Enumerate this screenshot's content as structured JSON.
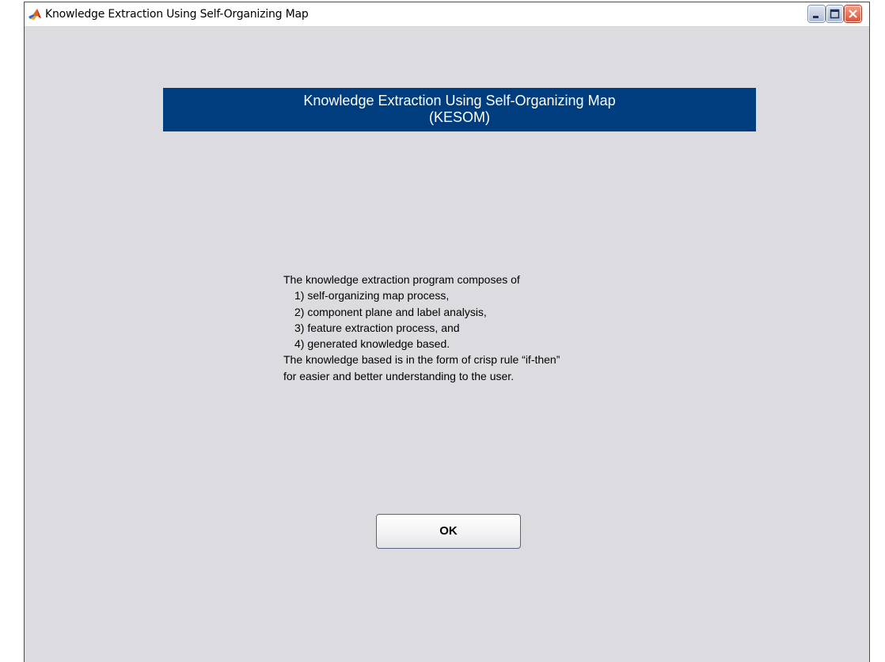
{
  "window": {
    "title": "Knowledge Extraction Using Self-Organizing Map",
    "controls": [
      "minimize-icon",
      "maximize-icon",
      "close-icon"
    ]
  },
  "header": {
    "line1": "Knowledge Extraction Using Self-Organizing Map",
    "line2": "(KESOM)"
  },
  "description": {
    "intro": "The knowledge extraction program composes of",
    "items": [
      "1) self-organizing map process,",
      "2) component plane and label analysis,",
      "3) feature extraction process, and",
      "4) generated knowledge based."
    ],
    "outro1": "The knowledge based is in the form of crisp rule “if-then”",
    "outro2": "for easier and better understanding to the user."
  },
  "actions": {
    "ok_label": "OK"
  },
  "colors": {
    "banner": "#003d7e",
    "background": "#dcdce0"
  }
}
